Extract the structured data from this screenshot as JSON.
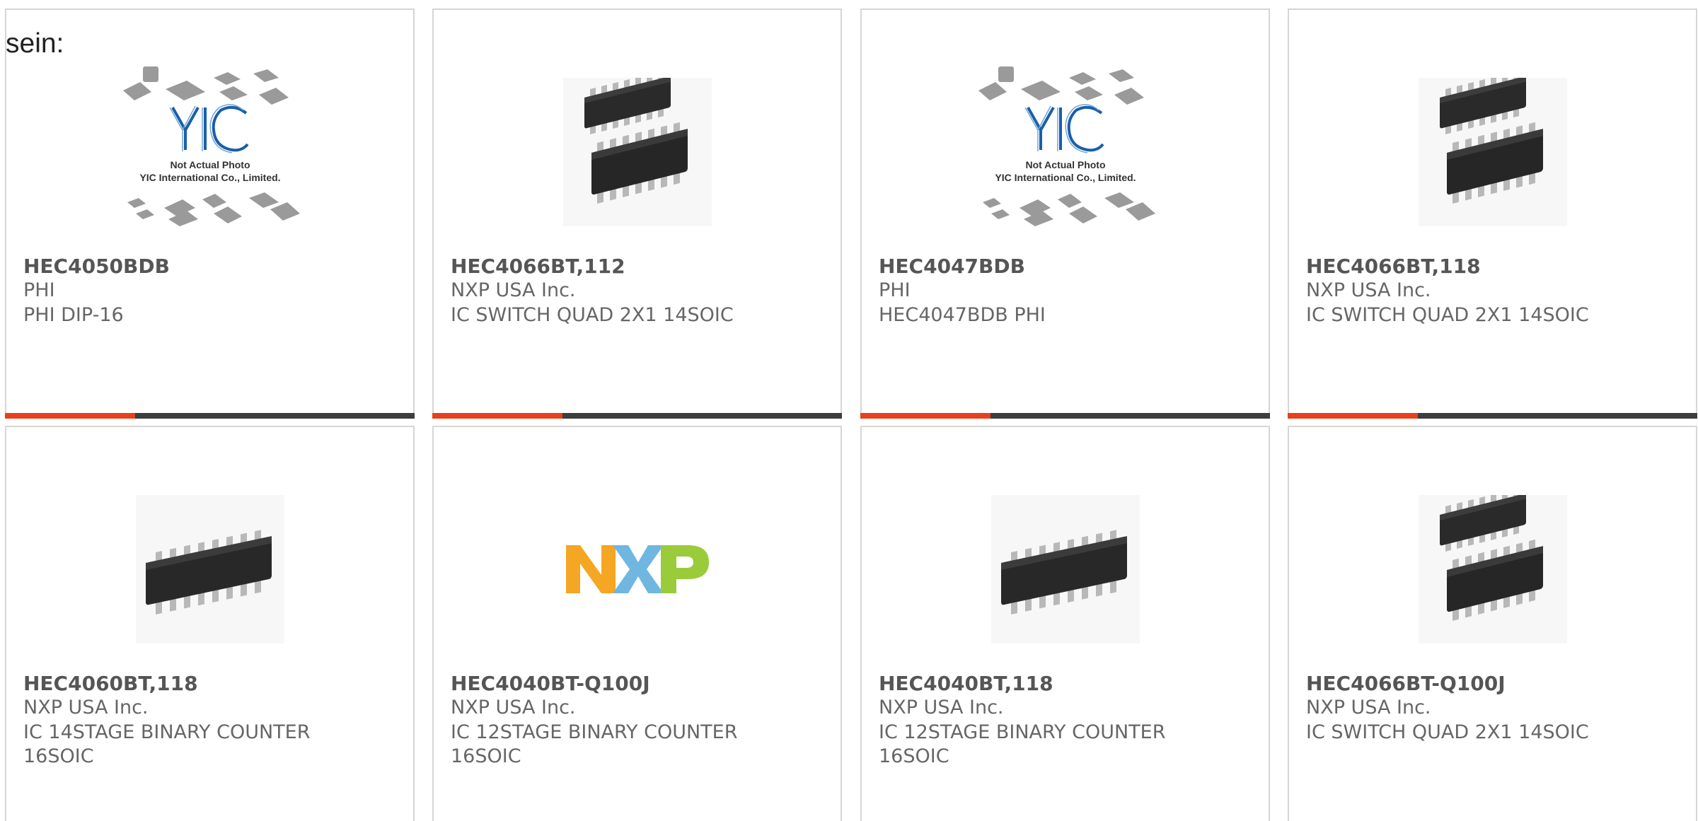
{
  "intro_text": "sein:",
  "colors": {
    "accent": "#e8401c",
    "bar": "#3d3d3d",
    "border": "#d6d6d6",
    "nxp_orange": "#f5a623",
    "nxp_blue": "#6fb7e0",
    "nxp_green": "#9acb3a",
    "yic_blue": "#1a5fa8"
  },
  "products": [
    {
      "part_number": "HEC4050BDB",
      "manufacturer": "PHI",
      "description": "PHI DIP-16",
      "image": "yic-placeholder-icon",
      "yic_placeholder": {
        "logo_text": "YIC",
        "line1": "Not Actual Photo",
        "line2": "YIC International Co., Limited."
      }
    },
    {
      "part_number": "HEC4066BT,112",
      "manufacturer": "NXP USA Inc.",
      "description": "IC SWITCH QUAD 2X1 14SOIC",
      "image": "soic-14-pair-icon"
    },
    {
      "part_number": "HEC4047BDB",
      "manufacturer": "PHI",
      "description": "HEC4047BDB PHI",
      "image": "yic-placeholder-icon",
      "yic_placeholder": {
        "logo_text": "YIC",
        "line1": "Not Actual Photo",
        "line2": "YIC International Co., Limited."
      }
    },
    {
      "part_number": "HEC4066BT,118",
      "manufacturer": "NXP USA Inc.",
      "description": "IC SWITCH QUAD 2X1 14SOIC",
      "image": "soic-14-pair-icon"
    },
    {
      "part_number": "HEC4060BT,118",
      "manufacturer": "NXP USA Inc.",
      "description": "IC 14STAGE BINARY COUNTER 16SOIC",
      "image": "soic-16-icon"
    },
    {
      "part_number": "HEC4040BT-Q100J",
      "manufacturer": "NXP USA Inc.",
      "description": "IC 12STAGE BINARY COUNTER 16SOIC",
      "image": "nxp-logo-icon"
    },
    {
      "part_number": "HEC4040BT,118",
      "manufacturer": "NXP USA Inc.",
      "description": "IC 12STAGE BINARY COUNTER 16SOIC",
      "image": "soic-16-icon"
    },
    {
      "part_number": "HEC4066BT-Q100J",
      "manufacturer": "NXP USA Inc.",
      "description": "IC SWITCH QUAD 2X1 14SOIC",
      "image": "soic-14-pair-icon"
    }
  ]
}
